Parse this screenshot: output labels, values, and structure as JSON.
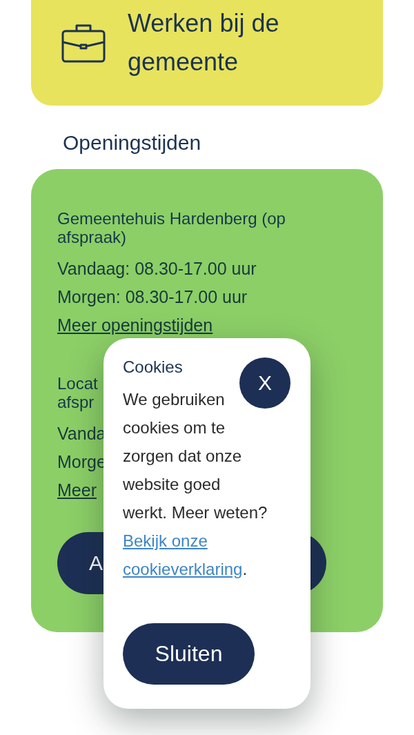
{
  "employment_card": {
    "title": "Werken bij de gemeente"
  },
  "opening_hours": {
    "heading": "Openingstijden",
    "locations": [
      {
        "name": "Gemeentehuis Hardenberg (op afspraak)",
        "lines": [
          "Vandaag: 08.30-17.00 uur",
          "Morgen: 08.30-17.00 uur"
        ],
        "link": "Meer openingstijden"
      },
      {
        "name": "Locat\nafspr",
        "lines": [
          "Vanda",
          "Morge"
        ],
        "link": "Meer"
      }
    ],
    "button": "A"
  },
  "cookie_popup": {
    "title": "Cookies",
    "close": "X",
    "message": "We gebruiken\ncookies om te\nzorgen dat onze\nwebsite goed\nwerkt. Meer weten?",
    "link": "Bekijk onze\ncookieverklaring",
    "suffix": ".",
    "button": "Sluiten"
  }
}
